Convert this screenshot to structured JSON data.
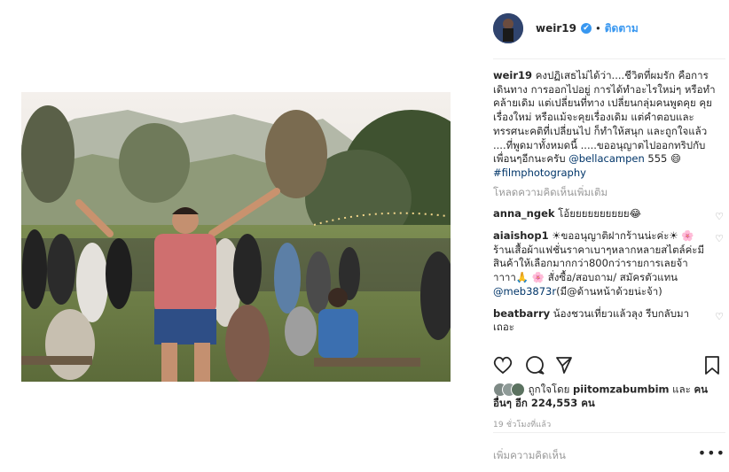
{
  "post": {
    "username": "weir19",
    "verified_mark": "✔",
    "separator": "•",
    "follow_label": "ติดตาม"
  },
  "caption": {
    "username": "weir19",
    "text": "คงปฏิเสธไม่ได้ว่า....ชีวิตที่ผมรัก คือการเดินทาง การออกไปอยู่ การได้ทำอะไรใหม่ๆ หรือทำคล้ายเดิม แต่เปลี่ยนที่ทาง เปลี่ยนกลุ่มคนพูดคุย คุยเรื่องใหม่ หรือแม้จะคุยเรื่องเดิม แต่คำตอบและทรรศนะคติที่เปลี่ยนไป ก็ทำให้สนุก และถูกใจแล้ว ....ที่พูดมาทั้งหมดนี้ .....ขออนุญาตไปออกทริปกับเพื่อนๆอีกนะครับ",
    "mention": "@bellacampen",
    "tail": " 555 😄 ",
    "hashtag": "#filmphotography"
  },
  "load_more": "โหลดความคิดเห็นเพิ่มเติม",
  "comments": [
    {
      "username": "anna_ngek",
      "text": "โอ้ยยยยยยยยยย😂"
    },
    {
      "username": "aiaishop1",
      "text": "☀ขออนุญาติฝากร้านน่ะค่ะ☀ 🌸 ร้านเสื้อผ้าแฟชั่นราคาเบาๆหลากหลายสไตล์ค่ะมีสินค้าให้เลือกมากกว่า800กว่ารายการเลยจ้าาาาา🙏 🌸 สั่งซื้อ/สอบถาม/ สมัครตัวแทน ",
      "mention": "@meb3873r",
      "tail": "(มี@ด้านหน้าด้วยน่ะจ้า)"
    },
    {
      "username": "beatbarry",
      "text": "น้องชวนเที่ยวแล้วลุง รีบกลับมาเถอะ"
    }
  ],
  "likes": {
    "prefix": "ถูกใจโดย",
    "user": "piitomzabumbim",
    "and": "และ",
    "others": "คนอื่นๆ อีก 224,553 คน"
  },
  "time_ago": "19 ชั่วโมงที่แล้ว",
  "add_comment_placeholder": "เพิ่มความคิดเห็น",
  "more_label": "•••",
  "icons": {
    "like": "heart-icon",
    "comment": "comment-icon",
    "share": "share-icon",
    "save": "bookmark-icon",
    "comment_like": "♡"
  },
  "colors": {
    "link": "#003569",
    "accent": "#3897f0",
    "muted": "#999999",
    "text": "#262626"
  }
}
